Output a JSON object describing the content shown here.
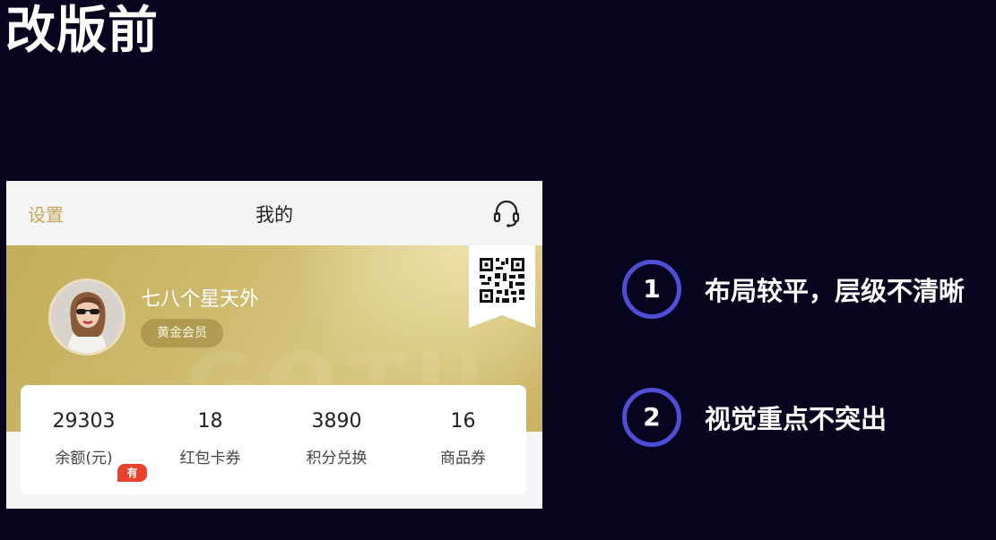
{
  "slide": {
    "title": "改版前"
  },
  "phone": {
    "header": {
      "settings_label": "设置",
      "title": "我的",
      "service_icon": "headset-icon"
    },
    "profile": {
      "username": "七八个星天外",
      "member_level": "黄金会员",
      "qr_icon": "qr-code-icon"
    },
    "stats": [
      {
        "value": "29303",
        "label": "余额(元)",
        "badge": "有礼"
      },
      {
        "value": "18",
        "label": "红包卡券"
      },
      {
        "value": "3890",
        "label": "积分兑换"
      },
      {
        "value": "16",
        "label": "商品券"
      }
    ],
    "colors": {
      "gold": "#cdb96b",
      "accent_text": "#c9a55a",
      "badge_red": "#e8412e"
    }
  },
  "notes": [
    {
      "number": "1",
      "text": "布局较平，层级不清晰"
    },
    {
      "number": "2",
      "text": "视觉重点不突出"
    }
  ],
  "colors": {
    "background": "#07041f",
    "note_ring": "#4f4ed8"
  }
}
